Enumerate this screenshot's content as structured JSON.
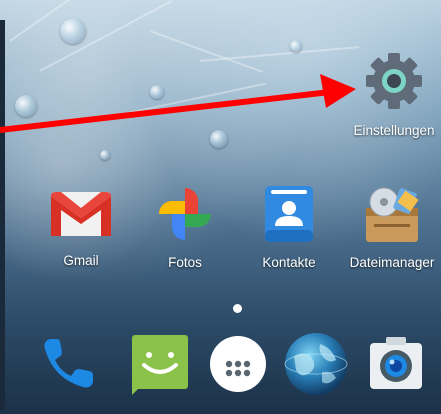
{
  "settings_app": {
    "label": "Einstellungen",
    "icon": "gear-icon"
  },
  "home_apps": [
    {
      "label": "Gmail",
      "icon": "gmail-icon"
    },
    {
      "label": "Fotos",
      "icon": "photos-pinwheel-icon"
    },
    {
      "label": "Kontakte",
      "icon": "contacts-icon"
    },
    {
      "label": "Dateimanager",
      "icon": "file-manager-icon"
    }
  ],
  "dock": [
    {
      "icon": "phone-icon"
    },
    {
      "icon": "messaging-icon"
    },
    {
      "icon": "app-drawer-icon"
    },
    {
      "icon": "browser-globe-icon"
    },
    {
      "icon": "camera-icon"
    }
  ],
  "page_indicator": {
    "current_page": 1,
    "total_pages": 1
  },
  "annotation": {
    "type": "arrow",
    "color": "#ff0000",
    "points_to": "Einstellungen"
  },
  "colors": {
    "arrow": "#ff0000",
    "gmail_red": "#d93025",
    "contacts_blue": "#2f8ae0",
    "messaging_green": "#8bc34a",
    "phone_blue": "#1e88e5"
  }
}
